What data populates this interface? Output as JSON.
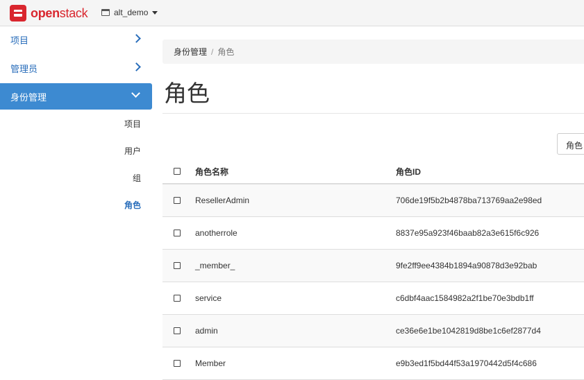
{
  "topbar": {
    "brand_part1": "open",
    "brand_part2": "stack",
    "project": "alt_demo"
  },
  "sidebar": {
    "items": [
      {
        "label": "项目"
      },
      {
        "label": "管理员"
      },
      {
        "label": "身份管理"
      }
    ],
    "sub_items": [
      {
        "label": "项目"
      },
      {
        "label": "用户"
      },
      {
        "label": "组"
      },
      {
        "label": "角色"
      }
    ]
  },
  "breadcrumb": {
    "parent": "身份管理",
    "separator": "/",
    "current": "角色"
  },
  "page": {
    "title": "角色",
    "filter_button": "角色"
  },
  "table": {
    "headers": {
      "name": "角色名称",
      "id": "角色ID"
    },
    "rows": [
      {
        "name": "ResellerAdmin",
        "id": "706de19f5b2b4878ba713769aa2e98ed"
      },
      {
        "name": "anotherrole",
        "id": "8837e95a923f46baab82a3e615f6c926"
      },
      {
        "name": "_member_",
        "id": "9fe2ff9ee4384b1894a90878d3e92bab"
      },
      {
        "name": "service",
        "id": "c6dbf4aac1584982a2f1be70e3bdb1ff"
      },
      {
        "name": "admin",
        "id": "ce36e6e1be1042819d8be1c6ef2877d4"
      },
      {
        "name": "Member",
        "id": "e9b3ed1f5bd44f53a1970442d5f4c686"
      }
    ]
  }
}
